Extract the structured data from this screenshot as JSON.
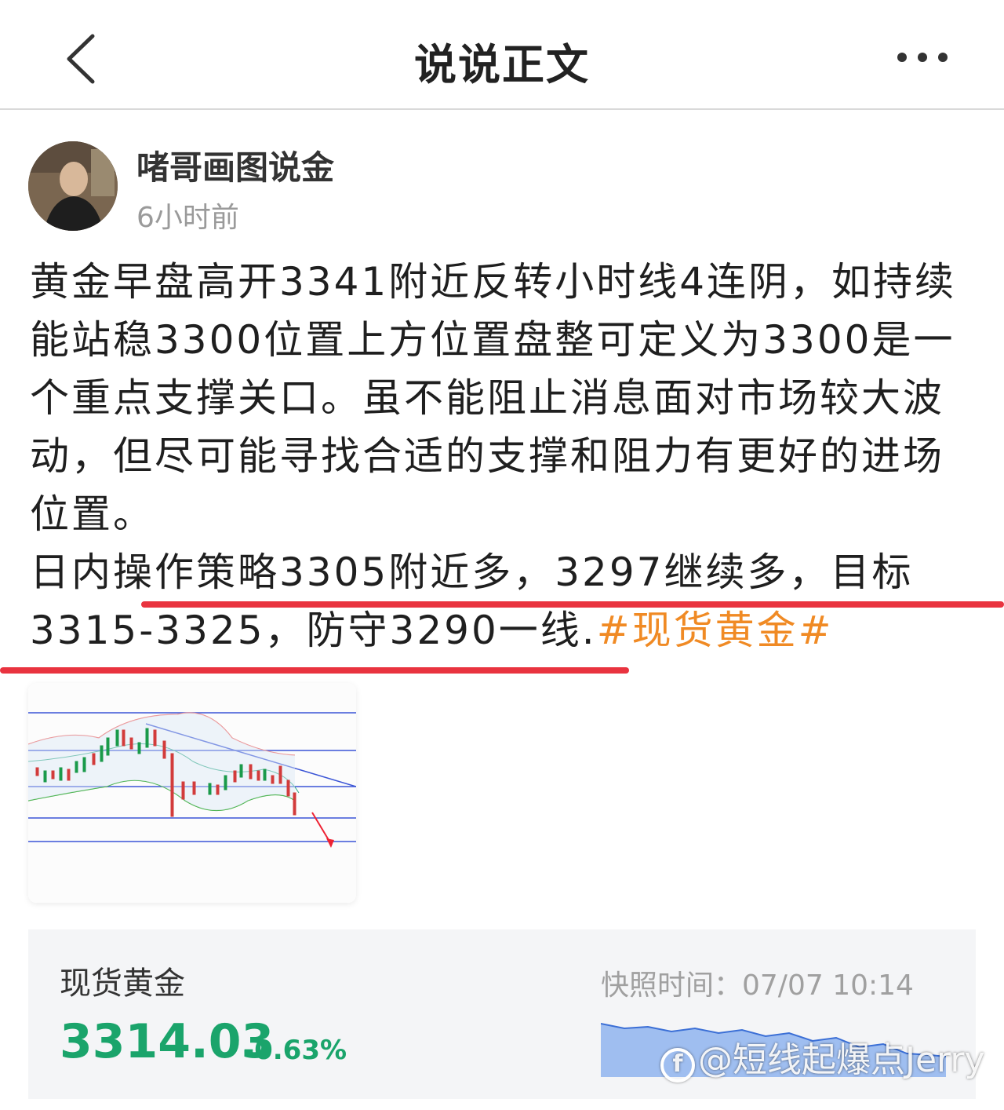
{
  "nav": {
    "title": "说说正文"
  },
  "author": {
    "name": "啫哥画图说金",
    "time": "6小时前"
  },
  "post": {
    "paragraph1": "黄金早盘高开3341附近反转小时线4连阴，如持续能站稳3300位置上方位置盘整可定义为3300是一个重点支撑关口。虽不能阻止消息面对市场较大波动，但尽可能寻找合适的支撑和阻力有更好的进场位置。",
    "paragraph2": "日内操作策略3305附近多，3297继续多，目标3315-3325，防守3290一线.",
    "hashtag": "#现货黄金#"
  },
  "quote_card": {
    "name": "现货黄金",
    "price": "3314.03",
    "change": "-0.63%",
    "snapshot": "快照时间：07/07 10:14"
  },
  "watermark": {
    "text": "@短线起爆点Jerry"
  },
  "colors": {
    "accent": "#f08a24",
    "price_green": "#1aa46b",
    "underline_red": "#e9333f"
  },
  "icons": {
    "back": "chevron-left-icon",
    "more": "more-dots-icon"
  }
}
